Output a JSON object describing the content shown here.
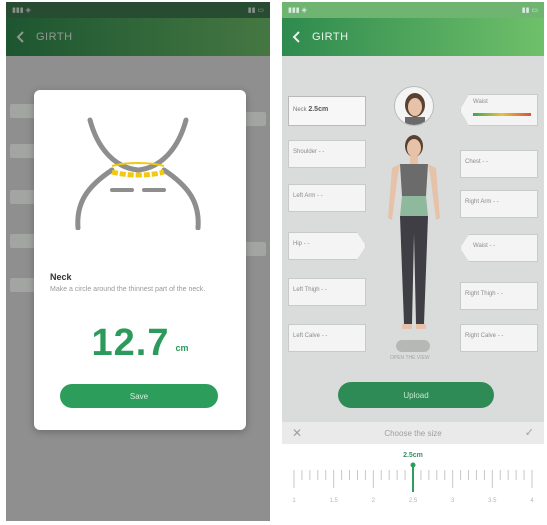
{
  "left": {
    "app_title": "GIRTH",
    "modal": {
      "title": "Neck",
      "description": "Make a circle around the thinnest part of the neck.",
      "value": "12.7",
      "unit": "cm",
      "save_label": "Save"
    }
  },
  "right": {
    "app_title": "GIRTH",
    "neck_label": "Neck",
    "neck_value": "2.5cm",
    "waist_label": "Waist",
    "boxes": [
      {
        "label": "Shoulder",
        "value": "- -"
      },
      {
        "label": "Chest",
        "value": "- -"
      },
      {
        "label": "Left Arm",
        "value": "- -"
      },
      {
        "label": "Right Arm",
        "value": "- -"
      },
      {
        "label": "Hip",
        "value": "- -"
      },
      {
        "label": "Waist",
        "value": "- -"
      },
      {
        "label": "Left Thigh",
        "value": "- -"
      },
      {
        "label": "Right Thigh",
        "value": "- -"
      },
      {
        "label": "Left Calve",
        "value": "- -"
      },
      {
        "label": "Right Calve",
        "value": "- -"
      }
    ],
    "toggle_label": "OPEN THE VIEW",
    "upload_label": "Upload",
    "sheet": {
      "title": "Choose the size",
      "close_icon": "close-icon",
      "confirm_icon": "check-icon",
      "current_value": "2.5cm",
      "ruler_labels": [
        "1",
        "1.5",
        "2",
        "2.5",
        "3",
        "3.5",
        "4"
      ]
    }
  },
  "colors": {
    "accent": "#2d9d5c",
    "appbar_start": "#2e8a4e",
    "appbar_end": "#6fc06a",
    "highlight": "#f2c811"
  }
}
